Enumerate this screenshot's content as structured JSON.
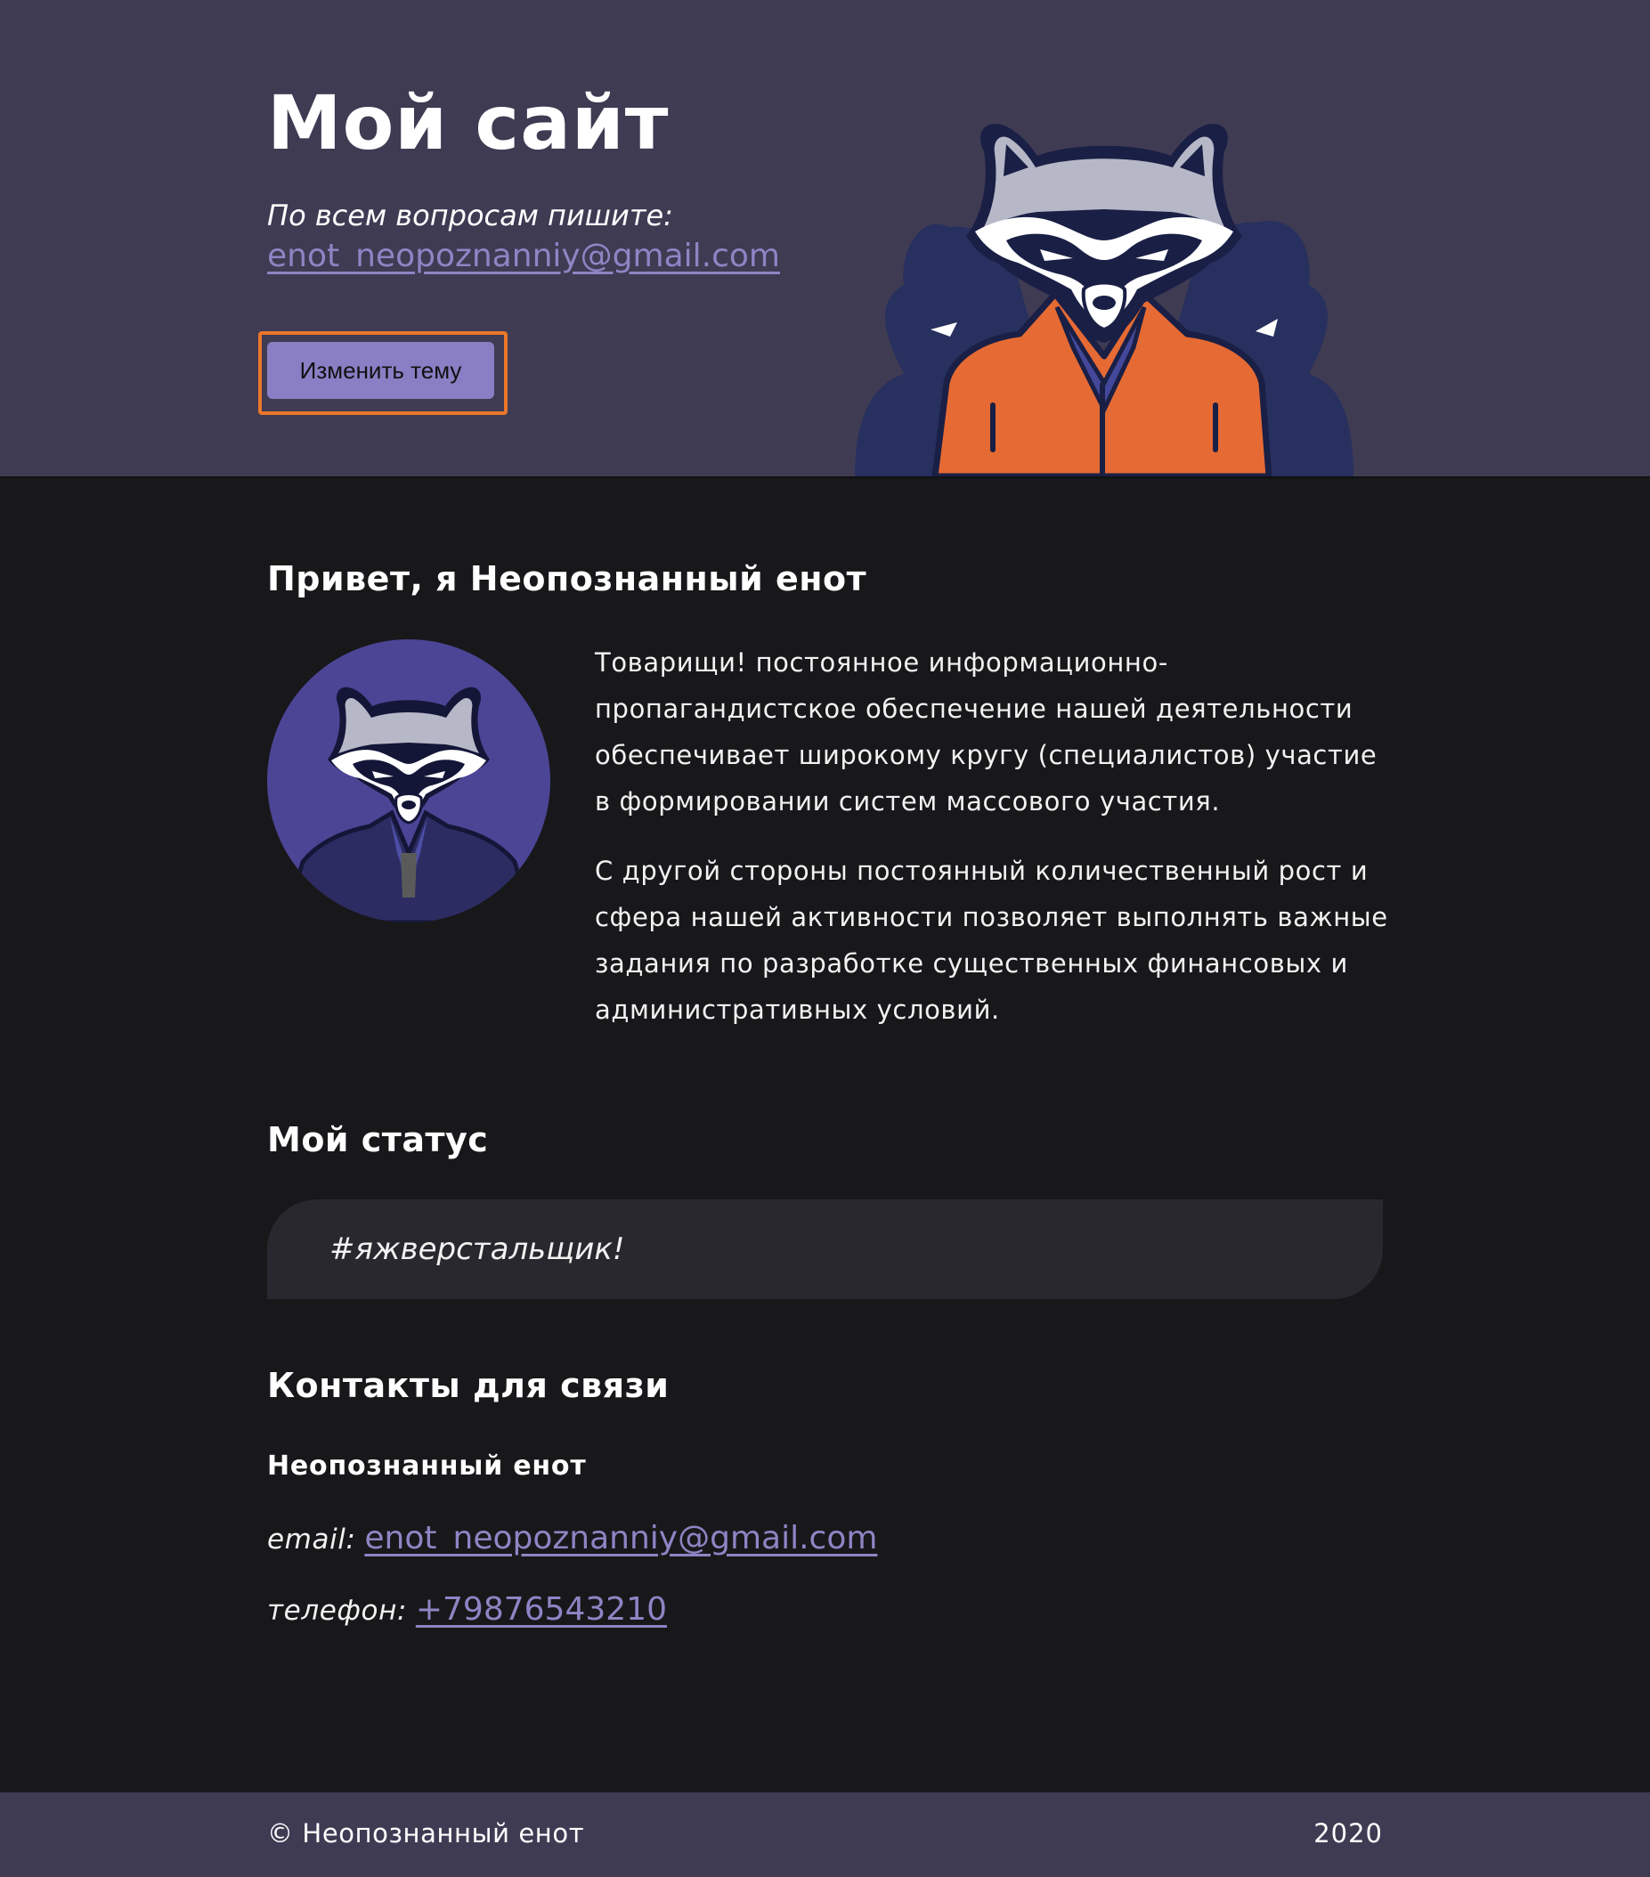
{
  "header": {
    "title": "Мой сайт",
    "contact_caption": "По всем вопросам пишите:",
    "email": "enot_neopoznanniy@gmail.com",
    "theme_button_label": "Изменить тему"
  },
  "about": {
    "title": "Привет, я Неопознанный енот",
    "paragraphs": [
      "Товарищи! постоянное информационно-пропагандистское обеспечение нашей деятельности обеспечивает широкому кругу (специалистов) участие в формировании систем массового участия.",
      "С другой стороны постоянный количественный рост и сфера нашей активности позволяет выполнять важные задания по разработке существенных финансовых и административных условий."
    ]
  },
  "status": {
    "title": "Мой статус",
    "text": "#яжверстальщик!"
  },
  "contacts": {
    "title": "Контакты для связи",
    "name": "Неопознанный енот",
    "email_label": "email:",
    "email": "enot_neopoznanniy@gmail.com",
    "phone_label": "телефон:",
    "phone": "+79876543210"
  },
  "footer": {
    "copyright": "© Неопознанный енот",
    "year": "2020"
  },
  "colors": {
    "header_bg": "#3f3b53",
    "page_bg": "#18181b",
    "link": "#8f84c4",
    "button": "#8a7ec4",
    "focus_outline": "#e9772a",
    "status_bg": "#29282f"
  }
}
